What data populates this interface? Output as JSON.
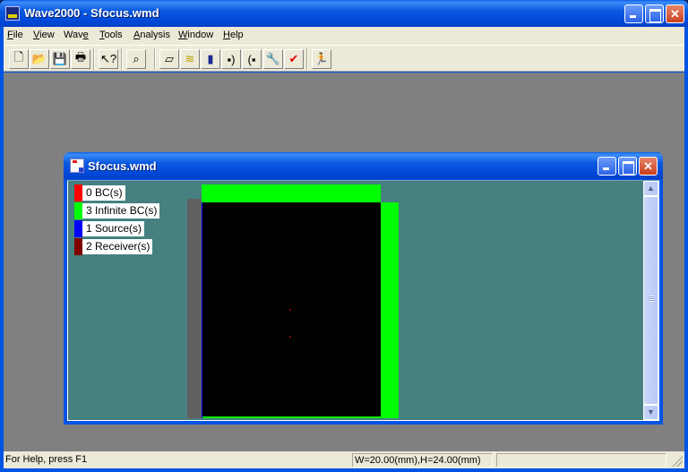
{
  "app": {
    "title": "Wave2000 - Sfocus.wmd",
    "menu": [
      {
        "label": "File",
        "accel": "F"
      },
      {
        "label": "View",
        "accel": "V"
      },
      {
        "label": "Wave",
        "accel": "e"
      },
      {
        "label": "Tools",
        "accel": "T"
      },
      {
        "label": "Analysis",
        "accel": "A"
      },
      {
        "label": "Window",
        "accel": "W"
      },
      {
        "label": "Help",
        "accel": "H"
      }
    ],
    "toolbar": [
      {
        "name": "new-icon",
        "glyph": "🗋"
      },
      {
        "name": "open-icon",
        "glyph": "📂"
      },
      {
        "name": "save-icon",
        "glyph": "💾"
      },
      {
        "name": "print-icon",
        "glyph": "🖶"
      },
      {
        "name": "context-help-icon",
        "glyph": "↖?"
      },
      {
        "name": "zoom-icon",
        "glyph": "⌕"
      },
      {
        "name": "geometry-icon",
        "glyph": "▱"
      },
      {
        "name": "material-icon",
        "glyph": "≋"
      },
      {
        "name": "boundary-icon",
        "glyph": "▮"
      },
      {
        "name": "source-icon",
        "glyph": "▪)"
      },
      {
        "name": "receiver-icon",
        "glyph": "(▪"
      },
      {
        "name": "settings-wrench-icon",
        "glyph": "🔧"
      },
      {
        "name": "check-icon",
        "glyph": "✔"
      },
      {
        "name": "run-icon",
        "glyph": "🏃"
      }
    ]
  },
  "document": {
    "title": "Sfocus.wmd",
    "legend": [
      {
        "label": "0 BC(s)",
        "color": "#ff0000"
      },
      {
        "label": "3 Infinite BC(s)",
        "color": "#00ff00"
      },
      {
        "label": "1 Source(s)",
        "color": "#0000ff"
      },
      {
        "label": "2 Receiver(s)",
        "color": "#800000"
      }
    ],
    "model": {
      "background": "#000000",
      "infinite_bc_color": "#00ff00",
      "source_edge_color": "#0000ff",
      "receiver_color": "#800000",
      "width_mm": 20.0,
      "height_mm": 24.0
    }
  },
  "status": {
    "help": "For Help, press F1",
    "dimensions": "W=20.00(mm),H=24.00(mm)",
    "extra": ""
  }
}
